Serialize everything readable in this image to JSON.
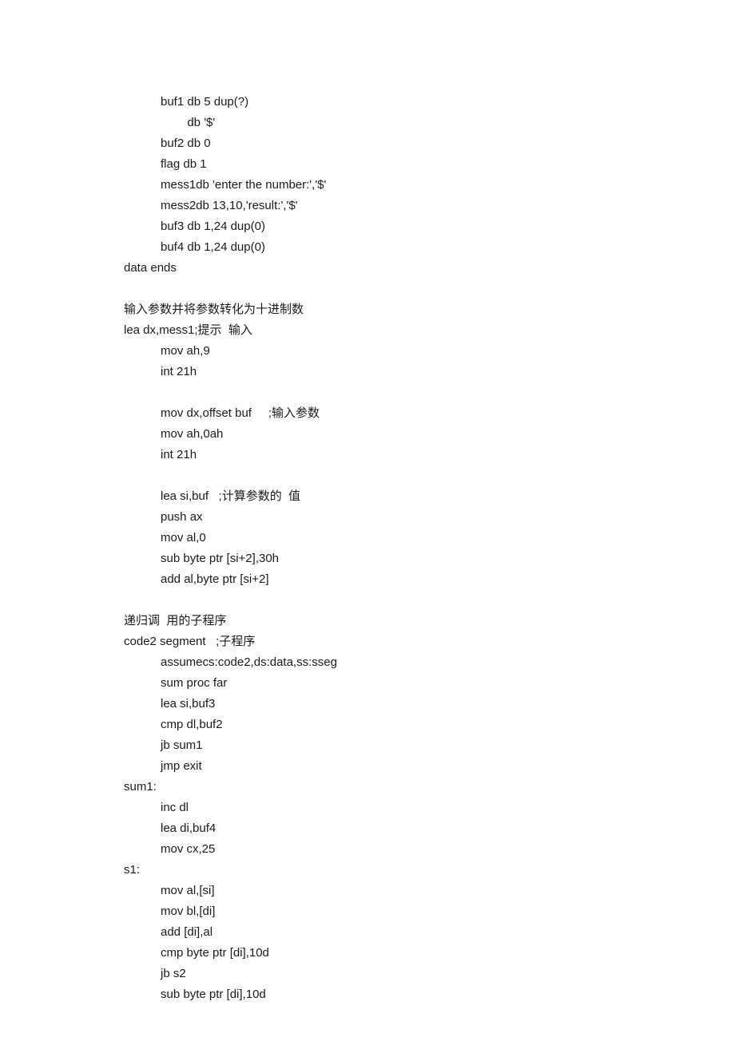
{
  "block1": {
    "l1": "buf1 db 5 dup(?)",
    "l2": "        db '$'",
    "l3": "buf2 db 0",
    "l4": "flag db 1",
    "l5": "mess1db 'enter the number:','$'",
    "l6": "mess2db 13,10,'result:','$'",
    "l7": "buf3 db 1,24 dup(0)",
    "l8": "buf4 db 1,24 dup(0)",
    "l9": "data ends"
  },
  "block2": {
    "h": "输入参数并将参数转化为十进制数",
    "l1": "lea dx,mess1;提示  输入",
    "l2": "mov ah,9",
    "l3": "int 21h",
    "l4": "mov dx,offset buf     ;输入参数",
    "l5": "mov ah,0ah",
    "l6": "int 21h",
    "l7": "lea si,buf   ;计算参数的  值",
    "l8": "push ax",
    "l9": "mov al,0",
    "l10": "sub byte ptr [si+2],30h",
    "l11": "add al,byte ptr [si+2]"
  },
  "block3": {
    "h": "递归调  用的子程序",
    "l1": "code2 segment   ;子程序",
    "l2": "assumecs:code2,ds:data,ss:sseg",
    "l3": "sum proc far",
    "l4": "lea si,buf3",
    "l5": "cmp dl,buf2",
    "l6": "jb sum1",
    "l7": "jmp exit",
    "l8": "sum1:",
    "l9": "inc dl",
    "l10": "lea di,buf4",
    "l11": "mov cx,25",
    "l12": "s1:",
    "l13": "mov al,[si]",
    "l14": "mov bl,[di]",
    "l15": "add [di],al",
    "l16": "cmp byte ptr [di],10d",
    "l17": "jb s2",
    "l18": "sub byte ptr [di],10d"
  }
}
